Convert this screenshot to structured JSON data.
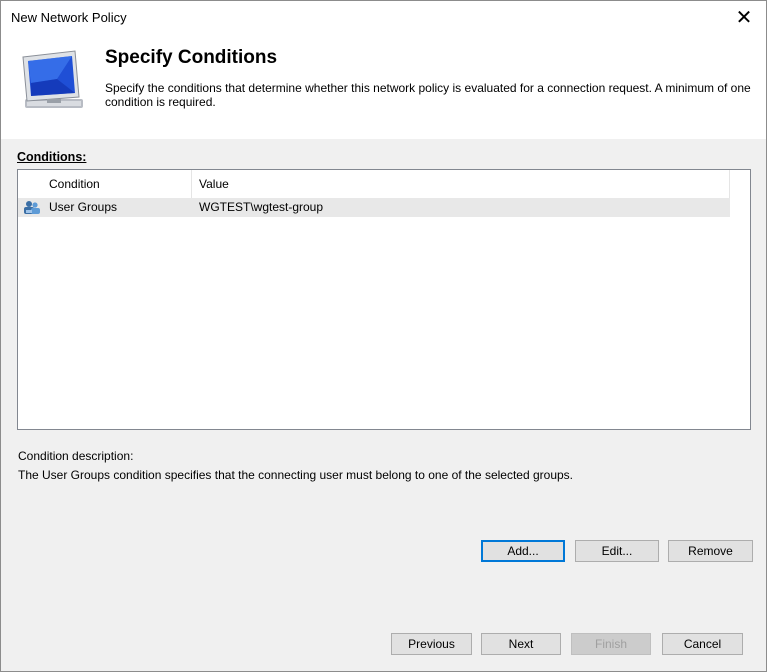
{
  "window": {
    "title": "New Network Policy",
    "close_glyph": "✕"
  },
  "header": {
    "title": "Specify Conditions",
    "description": "Specify the conditions that determine whether this network policy is evaluated for a connection request. A minimum of one condition is required.",
    "icon": "network-computer-icon"
  },
  "conditions": {
    "label": "Conditions:",
    "columns": [
      "Condition",
      "Value"
    ],
    "rows": [
      {
        "condition": "User Groups",
        "value": "WGTEST\\wgtest-group",
        "icon": "user-group-icon"
      }
    ]
  },
  "description_section": {
    "label": "Condition description:",
    "text": "The User Groups condition specifies that the connecting user must belong to one of the selected groups."
  },
  "buttons": {
    "add": "Add...",
    "edit": "Edit...",
    "remove": "Remove",
    "previous": "Previous",
    "next": "Next",
    "finish": "Finish",
    "cancel": "Cancel"
  },
  "colors": {
    "accent": "#0078d7",
    "window_bg": "#f0f0f0",
    "row_highlight": "#e8e8e8"
  }
}
